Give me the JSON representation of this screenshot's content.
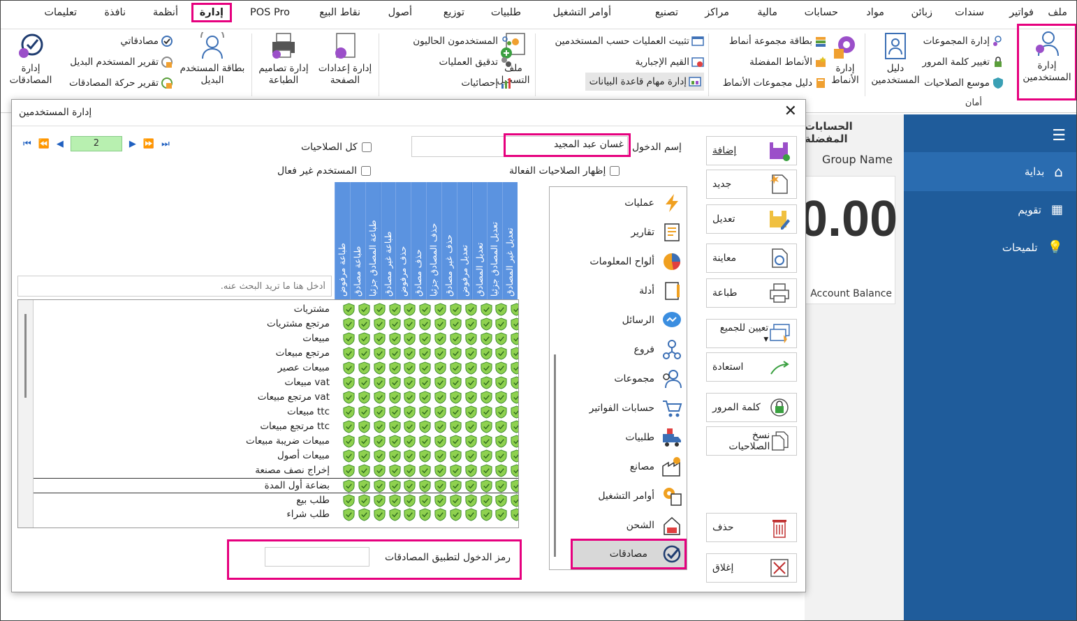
{
  "menubar": {
    "items": [
      "ملف",
      "فواتير",
      "سندات",
      "زبائن",
      "مواد",
      "حسابات",
      "مالية",
      "مراكز",
      "تصنيع",
      "أوامر التشغيل",
      "طلبيات",
      "توزيع",
      "أصول",
      "نقاط البيع",
      "POS Pro",
      "إدارة",
      "أنظمة",
      "نافذة",
      "تعليمات"
    ],
    "active": "إدارة"
  },
  "ribbon": {
    "users_mgmt": "إدارة المستخدمين",
    "group_mgmt": "إدارة المجموعات",
    "change_pwd": "تغيير كلمة المرور",
    "perm_wizard": "موسع الصلاحيات",
    "users_guide": "دليل المستخدمين",
    "security_group": "أمان",
    "patterns_mgmt": "إدارة الأنماط",
    "pattern_card": "بطاقة مجموعة أنماط",
    "fav_patterns": "الأنماط المفضلة",
    "pattern_guide": "دليل مجموعات الأنماط",
    "fix_ops": "تثبيت العمليات حسب المستخدمين",
    "mandatory": "القيم الإجبارية",
    "db_tasks": "إدارة مهام قاعدة البيانات",
    "login_file": "ملف التسجيل",
    "current_users": "المستخدمون الحاليون",
    "audit_ops": "تدقيق العمليات",
    "stats": "إحصائيات",
    "page_setup": "إدارة إعدادات الصفحة",
    "print_designs": "إدارة تصاميم الطباعة",
    "substitute_card": "بطاقة المستخدم البديل",
    "my_approvals": "مصادقاتي",
    "substitute_report": "تقرير المستخدم البديل",
    "approvals_report": "تقرير حركة المصادقات",
    "approvals_mgmt": "إدارة المصادقات"
  },
  "background": {
    "fav_accounts": "الحسابات المفضلة",
    "group_name": "Group Name",
    "amount": "0.00",
    "account_balance": "Account Balance"
  },
  "sidebar": {
    "items": [
      "بداية",
      "تقويم",
      "تلميحات"
    ]
  },
  "dialog": {
    "title": "إدارة المستخدمين",
    "login_label": "إسم الدخول",
    "login_value": "غسان عبد المجيد",
    "all_perms": "كل الصلاحيات",
    "show_active": "إظهار الصلاحيات الفعالة",
    "inactive_user": "المستخدم غير فعال",
    "page_number": "2",
    "search_placeholder": "أدخل هنا ما تريد البحث عنه.",
    "approval_token_label": "رمز الدخول لتطبيق المصادقات",
    "actions": [
      "إضافة",
      "جديد",
      "تعديل",
      "معاينة",
      "طباعة",
      "تعيين للجميع",
      "استعادة",
      "كلمة المرور",
      "نسخ الصلاحيات",
      "حذف",
      "إغلاق"
    ],
    "modules": [
      "عمليات",
      "تقارير",
      "ألواح المعلومات",
      "أدلة",
      "الرسائل",
      "فروع",
      "مجموعات",
      "حسابات الفواتير",
      "طلبيات",
      "مصانع",
      "أوامر التشغيل",
      "الشحن",
      "مصادقات"
    ],
    "selected_module": "مصادقات",
    "columns": [
      "تعديل غير المصادق",
      "تعديل المصادق جزئيا",
      "تعديل المصادق",
      "تعديل مرفوض",
      "حذف غير مصادق",
      "حذف المصادق جزئيا",
      "حذف مصادق",
      "حذف مرفوض",
      "طباعة غير مصادق",
      "طباعة المصادق جزئيا",
      "طباعة مصادق",
      "طباعة مرفوض"
    ],
    "rows": [
      "مشتريات",
      "مرتجع مشتريات",
      "مبيعات",
      "مرتجع مبيعات",
      "مبيعات عصير",
      "مبيعات vat",
      "مرتجع مبيعات vat",
      "مبيعات ttc",
      "مرتجع مبيعات ttc",
      "مبيعات ضريبة مبيعات",
      "مبيعات أصول",
      "إخراج نصف مصنعة",
      "بضاعة أول المدة",
      "طلب بيع",
      "طلب شراء"
    ]
  },
  "colors": {
    "highlight": "#e6007e",
    "sidebar": "#1f5c9b",
    "grid_header": "#4a86d8",
    "shield": "#8fd14f"
  }
}
